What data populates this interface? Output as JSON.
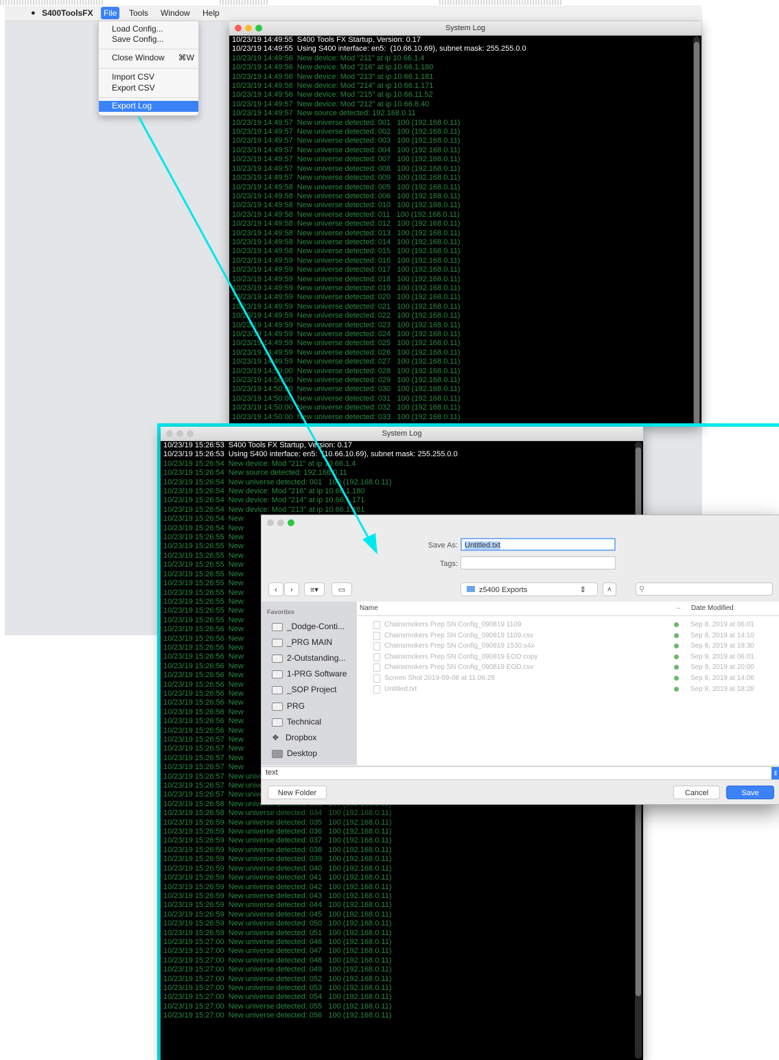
{
  "menubar": {
    "app_name": "S400ToolsFX",
    "menus": [
      "File",
      "Tools",
      "Window",
      "Help"
    ]
  },
  "file_menu": {
    "items": [
      "Load Config...",
      "Save Config...",
      "Close Window",
      "Import CSV",
      "Export CSV",
      "Export Log"
    ],
    "close_shortcut": "⌘W"
  },
  "log_window_1": {
    "title": "System Log",
    "lines": [
      "10/23/19 14:49:55  S400 Tools FX Startup, Version: 0.17",
      "10/23/19 14:49:55  Using S400 interface: en5:  (10.66.10.69), subnet mask: 255.255.0.0",
      "10/23/19 14:49:56  New device: Mod \"211\" at ip 10.66.1.4",
      "10/23/19 14:49:56  New device: Mod \"216\" at ip 10.66.1.180",
      "10/23/19 14:49:56  New device: Mod \"213\" at ip 10.66.1.181",
      "10/23/19 14:49:56  New device: Mod \"214\" at ip 10.66.1.171",
      "10/23/19 14:49:56  New device: Mod \"215\" at ip 10.66.11.52",
      "10/23/19 14:49:57  New device: Mod \"212\" at ip 10.66.8.40",
      "10/23/19 14:49:57  New source detected: 192.168.0.11",
      "10/23/19 14:49:57  New universe detected: 001   100 (192.168.0.11)",
      "10/23/19 14:49:57  New universe detected: 002   100 (192.168.0.11)",
      "10/23/19 14:49:57  New universe detected: 003   100 (192.168.0.11)",
      "10/23/19 14:49:57  New universe detected: 004   100 (192.168.0.11)",
      "10/23/19 14:49:57  New universe detected: 007   100 (192.168.0.11)",
      "10/23/19 14:49:57  New universe detected: 008   100 (192.168.0.11)",
      "10/23/19 14:49:57  New universe detected: 009   100 (192.168.0.11)",
      "10/23/19 14:49:58  New universe detected: 005   100 (192.168.0.11)",
      "10/23/19 14:49:58  New universe detected: 006   100 (192.168.0.11)",
      "10/23/19 14:49:58  New universe detected: 010   100 (192.168.0.11)",
      "10/23/19 14:49:58  New universe detected: 011   100 (192.168.0.11)",
      "10/23/19 14:49:58  New universe detected: 012   100 (192.168.0.11)",
      "10/23/19 14:49:58  New universe detected: 013   100 (192.168.0.11)",
      "10/23/19 14:49:58  New universe detected: 014   100 (192.168.0.11)",
      "10/23/19 14:49:58  New universe detected: 015   100 (192.168.0.11)",
      "10/23/19 14:49:59  New universe detected: 016   100 (192.168.0.11)",
      "10/23/19 14:49:59  New universe detected: 017   100 (192.168.0.11)",
      "10/23/19 14:49:59  New universe detected: 018   100 (192.168.0.11)",
      "10/23/19 14:49:59  New universe detected: 019   100 (192.168.0.11)",
      "10/23/19 14:49:59  New universe detected: 020   100 (192.168.0.11)",
      "10/23/19 14:49:59  New universe detected: 021   100 (192.168.0.11)",
      "10/23/19 14:49:59  New universe detected: 022   100 (192.168.0.11)",
      "10/23/19 14:49:59  New universe detected: 023   100 (192.168.0.11)",
      "10/23/19 14:49:59  New universe detected: 024   100 (192.168.0.11)",
      "10/23/19 14:49:59  New universe detected: 025   100 (192.168.0.11)",
      "10/23/19 14:49:59  New universe detected: 026   100 (192.168.0.11)",
      "10/23/19 14:49:59  New universe detected: 027   100 (192.168.0.11)",
      "10/23/19 14:50:00  New universe detected: 028   100 (192.168.0.11)",
      "10/23/19 14:50:00  New universe detected: 029   100 (192.168.0.11)",
      "10/23/19 14:50:00  New universe detected: 030   100 (192.168.0.11)",
      "10/23/19 14:50:00  New universe detected: 031   100 (192.168.0.11)",
      "10/23/19 14:50:00  New universe detected: 032   100 (192.168.0.11)",
      "10/23/19 14:50:00  New universe detected: 033   100 (192.168.0.11)"
    ]
  },
  "log_window_2": {
    "title": "System Log",
    "lines": [
      "10/23/19 15:26:53  S400 Tools FX Startup, Version: 0.17",
      "10/23/19 15:26:53  Using S400 interface: en5:  (10.66.10.69), subnet mask: 255.255.0.0",
      "10/23/19 15:26:54  New device: Mod \"211\" at ip 10.66.1.4",
      "10/23/19 15:26:54  New source detected: 192.168.0.11",
      "10/23/19 15:26:54  New universe detected: 001   100 (192.168.0.11)",
      "10/23/19 15:26:54  New device: Mod \"216\" at ip 10.66.1.180",
      "10/23/19 15:26:54  New device: Mod \"214\" at ip 10.66.1.171",
      "10/23/19 15:26:54  New device: Mod \"213\" at ip 10.66.1.181",
      "10/23/19 15:26:54  New",
      "10/23/19 15:26:54  New",
      "10/23/19 15:26:55  New",
      "10/23/19 15:26:55  New",
      "10/23/19 15:26:55  New",
      "10/23/19 15:26:55  New",
      "10/23/19 15:26:55  New",
      "10/23/19 15:26:55  New",
      "10/23/19 15:26:55  New",
      "10/23/19 15:26:55  New",
      "10/23/19 15:26:55  New",
      "10/23/19 15:26:55  New",
      "10/23/19 15:26:56  New",
      "10/23/19 15:26:56  New",
      "10/23/19 15:26:56  New",
      "10/23/19 15:26:56  New",
      "10/23/19 15:26:56  New",
      "10/23/19 15:26:56  New",
      "10/23/19 15:26:56  New",
      "10/23/19 15:26:56  New",
      "10/23/19 15:26:56  New",
      "10/23/19 15:26:56  New",
      "10/23/19 15:26:56  New",
      "10/23/19 15:26:56  New",
      "10/23/19 15:26:57  New",
      "10/23/19 15:26:57  New",
      "10/23/19 15:26:57  New",
      "10/23/19 15:26:57  New",
      "10/23/19 15:26:57  New universe detected: 030   100 (192.168.0.11)",
      "10/23/19 15:26:57  New universe detected: 031   100 (192.168.0.11)",
      "10/23/19 15:26:57  New universe detected: 032   100 (192.168.0.11)",
      "10/23/19 15:26:58  New universe detected: 033   100 (192.168.0.11)",
      "10/23/19 15:26:58  New universe detected: 034   100 (192.168.0.11)",
      "10/23/19 15:26:59  New universe detected: 035   100 (192.168.0.11)",
      "10/23/19 15:26:59  New universe detected: 036   100 (192.168.0.11)",
      "10/23/19 15:26:59  New universe detected: 037   100 (192.168.0.11)",
      "10/23/19 15:26:59  New universe detected: 038   100 (192.168.0.11)",
      "10/23/19 15:26:59  New universe detected: 039   100 (192.168.0.11)",
      "10/23/19 15:26:59  New universe detected: 040   100 (192.168.0.11)",
      "10/23/19 15:26:59  New universe detected: 041   100 (192.168.0.11)",
      "10/23/19 15:26:59  New universe detected: 042   100 (192.168.0.11)",
      "10/23/19 15:26:59  New universe detected: 043   100 (192.168.0.11)",
      "10/23/19 15:26:59  New universe detected: 044   100 (192.168.0.11)",
      "10/23/19 15:26:59  New universe detected: 045   100 (192.168.0.11)",
      "10/23/19 15:26:59  New universe detected: 050   100 (192.168.0.11)",
      "10/23/19 15:26:59  New universe detected: 051   100 (192.168.0.11)",
      "10/23/19 15:27:00  New universe detected: 046   100 (192.168.0.11)",
      "10/23/19 15:27:00  New universe detected: 047   100 (192.168.0.11)",
      "10/23/19 15:27:00  New universe detected: 048   100 (192.168.0.11)",
      "10/23/19 15:27:00  New universe detected: 049   100 (192.168.0.11)",
      "10/23/19 15:27:00  New universe detected: 052   100 (192.168.0.11)",
      "10/23/19 15:27:00  New universe detected: 053   100 (192.168.0.11)",
      "10/23/19 15:27:00  New universe detected: 054   100 (192.168.0.11)",
      "10/23/19 15:27:00  New universe detected: 055   100 (192.168.0.11)",
      "10/23/19 15:27:00  New universe detected: 056   100 (192.168.0.11)"
    ]
  },
  "save_dialog": {
    "save_as_label": "Save As:",
    "save_as_value": "Untitled.txt",
    "tags_label": "Tags:",
    "location": "z5400 Exports",
    "favorites_header": "Favorites",
    "favorites": [
      "_Dodge-Conti...",
      "_PRG MAIN",
      "2-Outstanding...",
      "1-PRG Software",
      "_SOP Project",
      "PRG",
      "Technical",
      "Dropbox",
      "Desktop"
    ],
    "col_name": "Name",
    "col_date": "Date Modified",
    "files": [
      {
        "name": "Chainsmokers Prep SN Config_090819 1109",
        "date": "Sep 8, 2019 at 06:01"
      },
      {
        "name": "Chainsmokers Prep SN Config_090819 1109.csv",
        "date": "Sep 8, 2019 at 14:10"
      },
      {
        "name": "Chainsmokers Prep SN Config_090819 1530.s4x",
        "date": "Sep 8, 2019 at 18:30"
      },
      {
        "name": "Chainsmokers Prep SN Config_090819 EOD copy",
        "date": "Sep 9, 2019 at 06:01"
      },
      {
        "name": "Chainsmokers Prep SN Config_090819 EOD.csv",
        "date": "Sep 9, 2019 at 20:00"
      },
      {
        "name": "Screen Shot 2019-09-08 at 11.06.28",
        "date": "Sep 8, 2019 at 14:06"
      },
      {
        "name": "Untitled.txt",
        "date": "Sep 8, 2019 at 18:28"
      }
    ],
    "format_value": "text",
    "new_folder_label": "New Folder",
    "cancel_label": "Cancel",
    "save_label": "Save"
  },
  "colors": {
    "accent": "#3b82f6",
    "highlight_frame": "#00e8ee",
    "log_green": "#38b85a",
    "log_white": "#ffffff"
  }
}
